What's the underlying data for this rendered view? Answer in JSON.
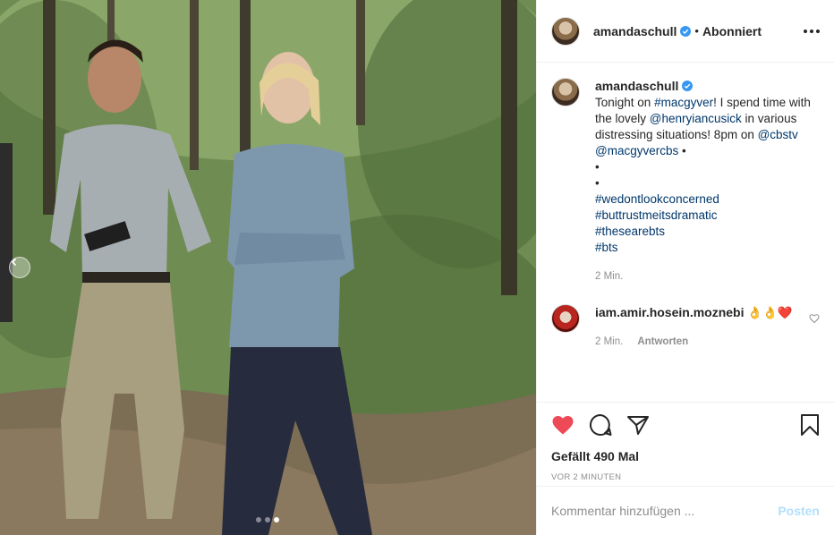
{
  "post": {
    "username": "amandaschull",
    "separator": "•",
    "follow_label": "Abonniert",
    "more_icon": "more-horizontal-icon",
    "photo": {
      "carousel_dots": 3,
      "active_dot": 2
    }
  },
  "caption": {
    "username": "amandaschull",
    "text_1": "Tonight on ",
    "tag_macgyver": "#macgyver",
    "text_2": "! I spend time with the lovely ",
    "mention_henry": "@henryiancusick",
    "text_3": " in various distressing situations! 8pm on ",
    "mention_cbstv": "@cbstv",
    "mention_macgyvercbs": "@macgyvercbs",
    "bullet": "•",
    "bullet_line_1": "•",
    "bullet_line_2": "•",
    "hashtags": [
      "#wedontlookconcerned",
      "#buttrustmeitsdramatic",
      "#thesearebts",
      "#bts"
    ],
    "time": "2 Min."
  },
  "comment": {
    "username": "iam.amir.hosein.moznebi",
    "text": "👌👌❤️",
    "time": "2 Min.",
    "reply_label": "Antworten"
  },
  "actions": {
    "likes": "Gefällt 490 Mal",
    "timestamp": "VOR 2 MINUTEN",
    "like_color": "#ed4956"
  },
  "add_comment": {
    "placeholder": "Kommentar hinzufügen ...",
    "post_label": "Posten"
  }
}
